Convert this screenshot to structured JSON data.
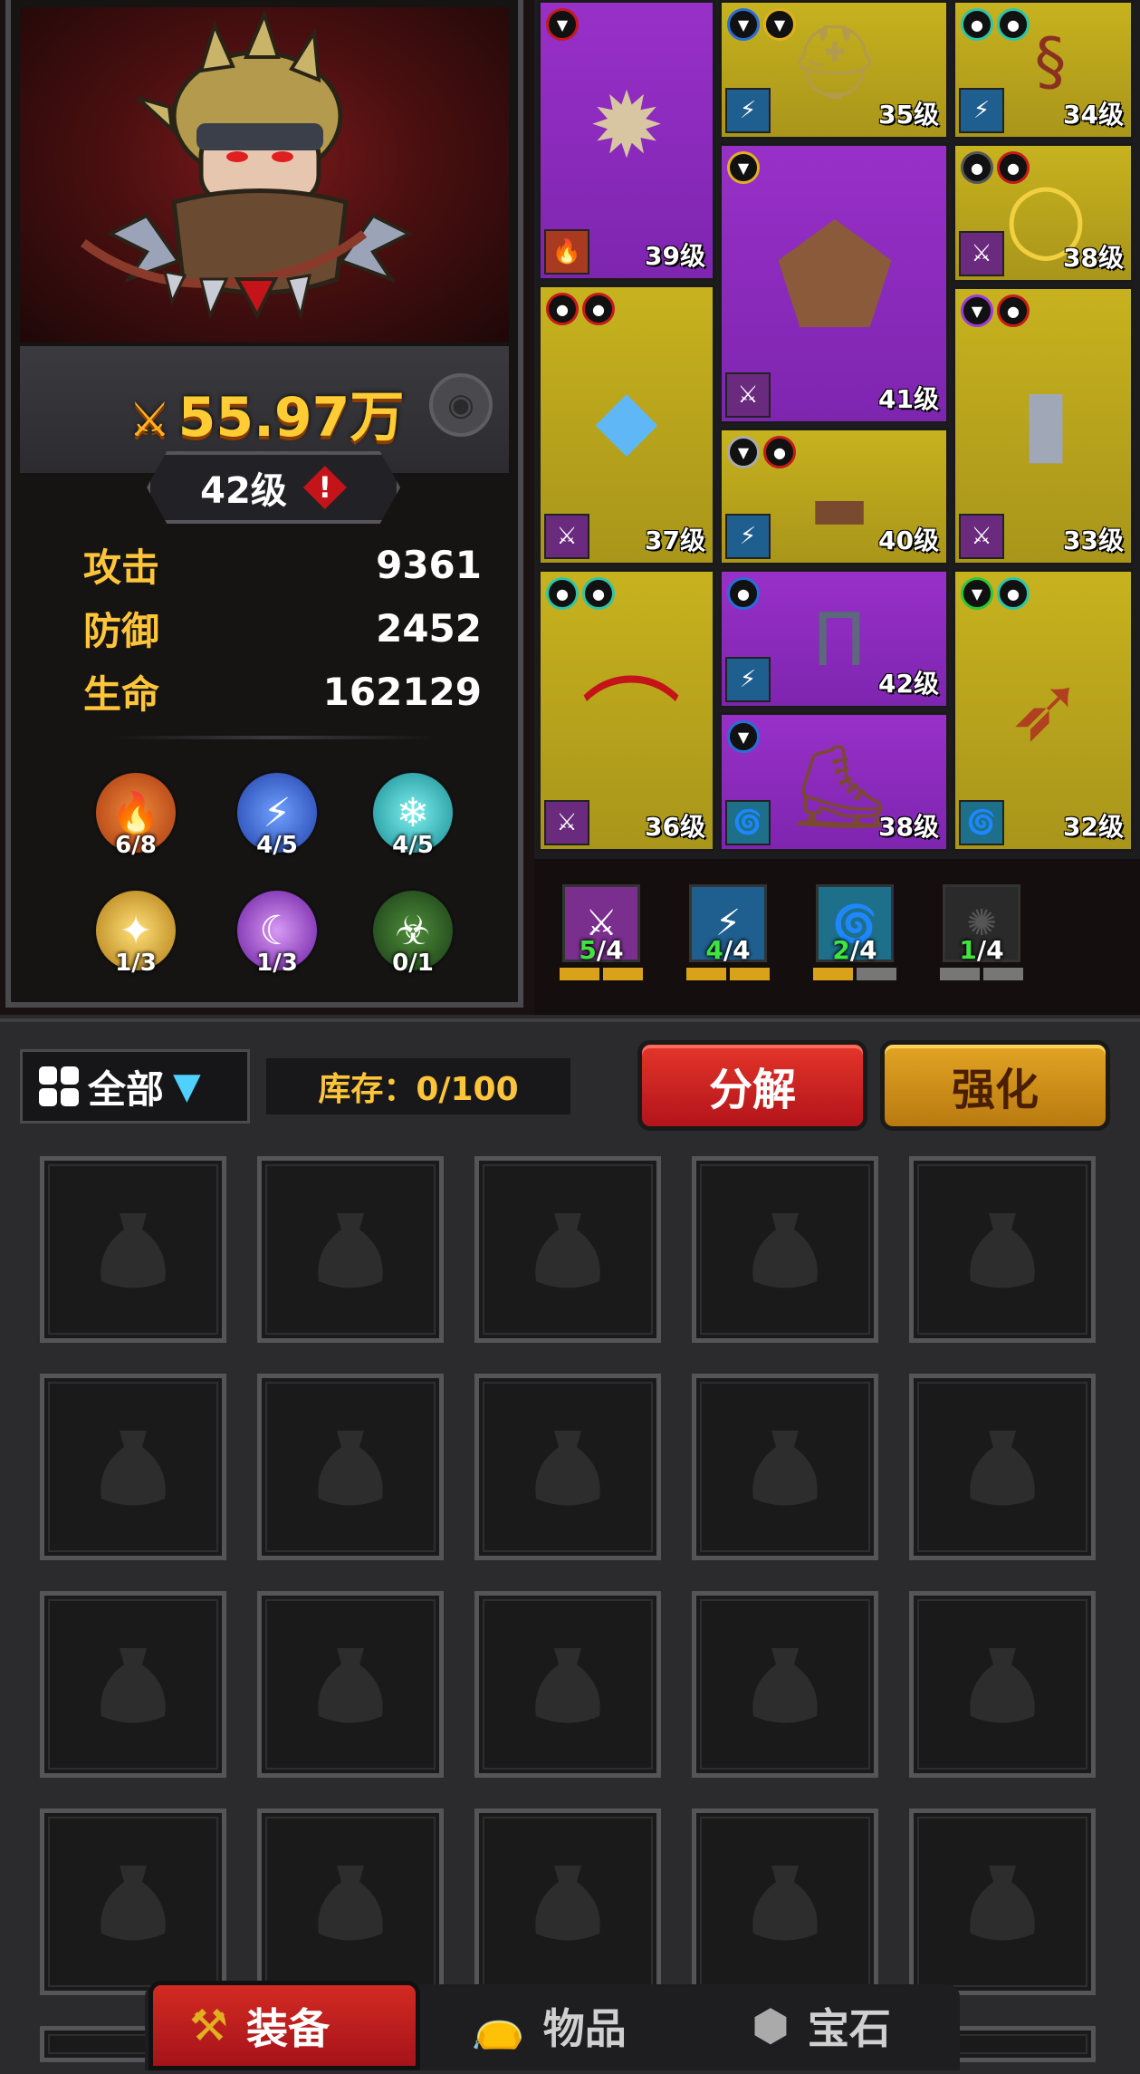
{
  "character": {
    "power": "55.97万",
    "level": "42级",
    "stats": [
      {
        "label": "攻击",
        "value": "9361"
      },
      {
        "label": "防御",
        "value": "2452"
      },
      {
        "label": "生命",
        "value": "162129"
      }
    ],
    "elements": [
      {
        "icon": "fire-icon",
        "count": "6/8",
        "color": "#e0561c"
      },
      {
        "icon": "lightning-icon",
        "count": "4/5",
        "color": "#3a6ee0"
      },
      {
        "icon": "snowflake-icon",
        "count": "4/5",
        "color": "#2ec6c8"
      },
      {
        "icon": "star-icon",
        "count": "1/3",
        "color": "#e0b020"
      },
      {
        "icon": "moon-icon",
        "count": "1/3",
        "color": "#9a3ad8"
      },
      {
        "icon": "poison-icon",
        "count": "0/1",
        "color": "#2f7a2a"
      }
    ]
  },
  "equipment": [
    {
      "name": "spiked-collar",
      "rarity": "purple",
      "level": "39级",
      "gems": [
        "red"
      ],
      "set": "fire"
    },
    {
      "name": "spiked-helmet",
      "rarity": "gold",
      "level": "35级",
      "gems": [
        "blue",
        "gold"
      ],
      "set": "lightning"
    },
    {
      "name": "scarf",
      "rarity": "gold",
      "level": "34级",
      "gems": [
        "cyan",
        "cyan"
      ],
      "set": "lightning"
    },
    {
      "name": "leather-armor",
      "rarity": "purple",
      "level": "41级",
      "gems": [
        "gold"
      ],
      "set": "blades"
    },
    {
      "name": "ring",
      "rarity": "gold",
      "level": "38级",
      "gems": [
        "dark",
        "red"
      ],
      "set": "blades"
    },
    {
      "name": "crystal-gauntlet",
      "rarity": "gold",
      "level": "37级",
      "gems": [
        "red",
        "red"
      ],
      "set": "blades"
    },
    {
      "name": "belt",
      "rarity": "gold",
      "level": "40级",
      "gems": [
        "silver",
        "red"
      ],
      "set": "lightning"
    },
    {
      "name": "bracer",
      "rarity": "gold",
      "level": "33级",
      "gems": [
        "purple",
        "red"
      ],
      "set": "blades"
    },
    {
      "name": "bone-bow",
      "rarity": "gold",
      "level": "36级",
      "gems": [
        "cyan",
        "cyan"
      ],
      "set": "blades"
    },
    {
      "name": "pants",
      "rarity": "purple",
      "level": "42级",
      "gems": [
        "blue"
      ],
      "set": "lightning"
    },
    {
      "name": "boots",
      "rarity": "purple",
      "level": "38级",
      "gems": [
        "blue"
      ],
      "set": "vortex"
    },
    {
      "name": "feather-quiver",
      "rarity": "gold",
      "level": "32级",
      "gems": [
        "green",
        "cyan"
      ],
      "set": "vortex"
    }
  ],
  "sets": [
    {
      "icon": "blades-set-icon",
      "have": "5",
      "total": "/4",
      "filled": 2,
      "color": "#7a2f8e"
    },
    {
      "icon": "lightning-set-icon",
      "have": "4",
      "total": "/4",
      "filled": 2,
      "color": "#1f5f8f"
    },
    {
      "icon": "vortex-set-icon",
      "have": "2",
      "total": "/4",
      "filled": 1,
      "color": "#1d6f8a"
    },
    {
      "icon": "tentacle-set-icon",
      "have": "1",
      "total": "/4",
      "filled": 0,
      "color": "#2a2a2a"
    }
  ],
  "inventory": {
    "filter_label": "全部",
    "storage_label": "库存：0/100",
    "decompose_label": "分解",
    "enhance_label": "强化"
  },
  "tabs": [
    {
      "label": "装备",
      "icon": "hammer-icon",
      "active": true
    },
    {
      "label": "物品",
      "icon": "bag-icon",
      "active": false
    },
    {
      "label": "宝石",
      "icon": "gem-icon",
      "active": false
    }
  ]
}
